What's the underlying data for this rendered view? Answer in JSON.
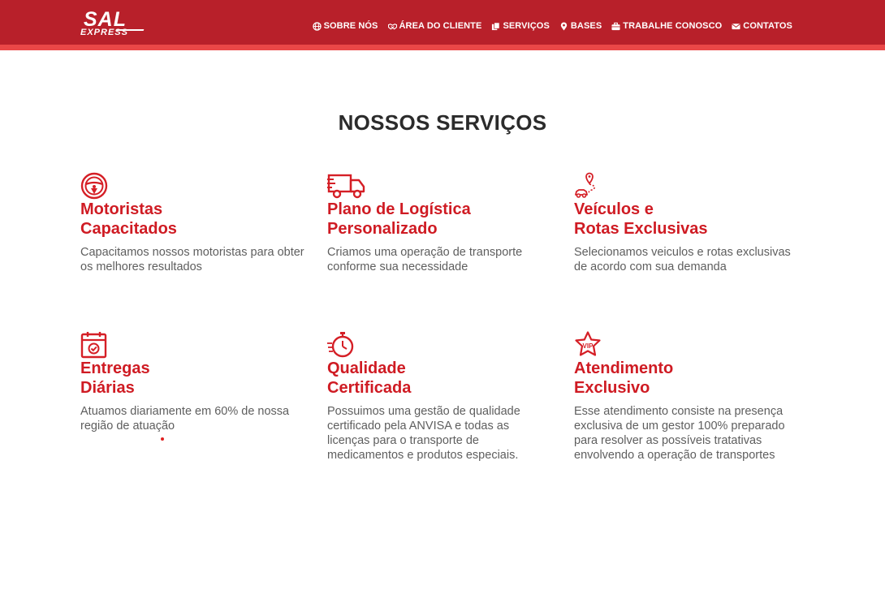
{
  "brand": {
    "logo_line1": "SAL",
    "logo_line2": "EXPRESS",
    "primary_color": "#b8202a",
    "accent_stripe_color": "#ea4747",
    "heading_red": "#cf1b23"
  },
  "nav": {
    "items": [
      {
        "label": "SOBRE NÓS",
        "icon": "globe-icon"
      },
      {
        "label": "ÁREA DO CLIENTE",
        "icon": "handshake-icon"
      },
      {
        "label": "SERVIÇOS",
        "icon": "copy-icon"
      },
      {
        "label": "BASES",
        "icon": "map-marker-icon"
      },
      {
        "label": "TRABALHE CONOSCO",
        "icon": "briefcase-icon"
      },
      {
        "label": "CONTATOS",
        "icon": "envelope-icon"
      }
    ]
  },
  "main": {
    "title": "NOSSOS SERVIÇOS",
    "services": [
      {
        "icon": "steering-wheel-icon",
        "title_line1": "Motoristas",
        "title_line2": "Capacitados",
        "description": "Capacitamos nossos motoristas para obter os melhores resultados"
      },
      {
        "icon": "delivery-truck-icon",
        "title_line1": "Plano de Logística",
        "title_line2": "Personalizado",
        "description": "Criamos uma operação de transporte conforme sua necessidade"
      },
      {
        "icon": "route-car-icon",
        "title_line1": "Veículos e",
        "title_line2": "Rotas Exclusivas",
        "description": "Selecionamos veiculos e rotas exclusivas de acordo com sua demanda"
      },
      {
        "icon": "calendar-check-icon",
        "title_line1": "Entregas",
        "title_line2": "Diárias",
        "description": "Atuamos diariamente em 60% de nossa região de atuação"
      },
      {
        "icon": "stopwatch-icon",
        "title_line1": "Qualidade",
        "title_line2": "Certificada",
        "description": "Possuimos uma gestão de qualidade certificado pela ANVISA e todas as licenças para o transporte de medicamentos e produtos especiais."
      },
      {
        "icon": "vip-star-icon",
        "title_line1": "Atendimento",
        "title_line2": "Exclusivo",
        "description": "Esse atendimento consiste na presença exclusiva de um gestor 100% preparado para resolver as possíveis tratativas envolvendo a operação de transportes"
      }
    ]
  }
}
